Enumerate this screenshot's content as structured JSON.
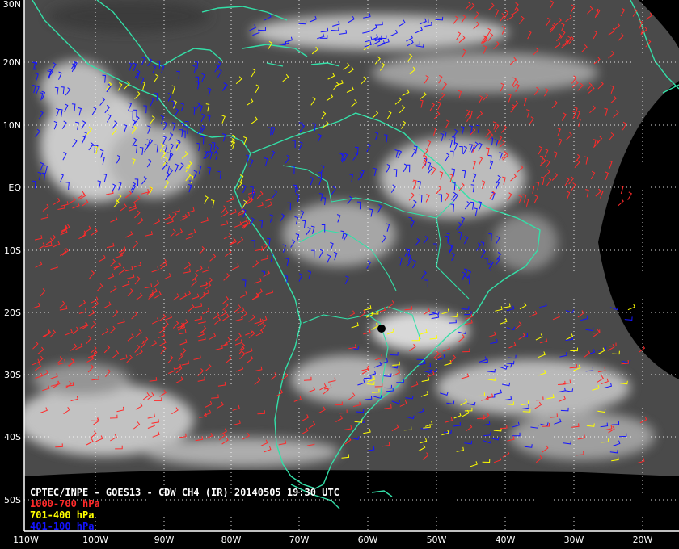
{
  "title": "CPTEC/INPE - GOES13 - CDW CH4 (IR) 20140505 19:30 UTC",
  "legend": [
    {
      "label": "1000-700 hPa",
      "color": "#ff2a2a"
    },
    {
      "label": "701-400 hPa",
      "color": "#ffff00"
    },
    {
      "label": "401-100 hPa",
      "color": "#1414ff"
    }
  ],
  "lat_labels": [
    "30N",
    "20N",
    "10N",
    "EQ",
    "10S",
    "20S",
    "30S",
    "40S",
    "50S"
  ],
  "lon_labels": [
    "110W",
    "100W",
    "90W",
    "80W",
    "70W",
    "60W",
    "50W",
    "40W",
    "30W",
    "20W"
  ],
  "colors": {
    "background": "#000000",
    "coast": "#33e0a8",
    "grid": "#ffffff",
    "cloud_base": "#555555"
  }
}
